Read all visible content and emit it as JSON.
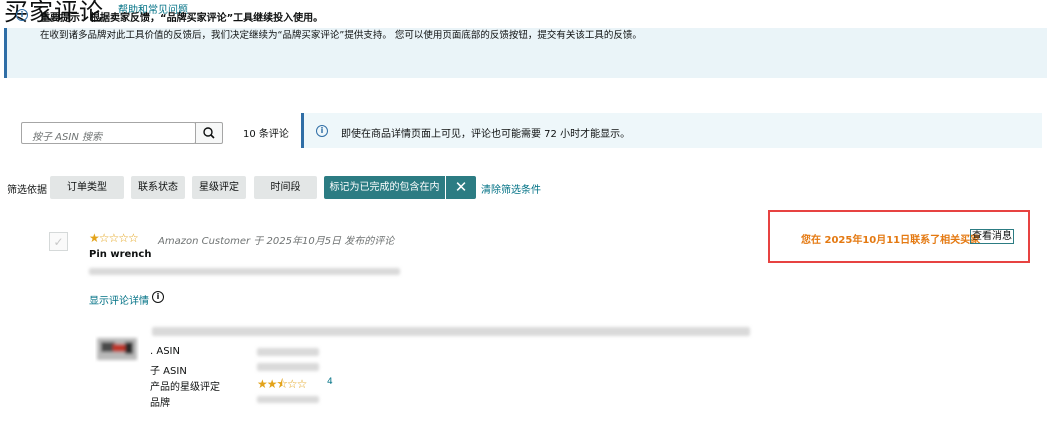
{
  "page": {
    "title": "买家评论",
    "help_link": "帮助和常见问题"
  },
  "alert": {
    "line1": "重要提示：根据卖家反馈，“品牌买家评论”工具继续投入使用。",
    "line2": "在收到诸多品牌对此工具价值的反馈后，我们决定继续为“品牌买家评论”提供支持。 您可以使用页面底部的反馈按钮，提交有关该工具的反馈。"
  },
  "search": {
    "placeholder": "按子 ASIN 搜索",
    "review_count": "10 条评论"
  },
  "info": {
    "text": "即使在商品详情页面上可见，评论也可能需要 72 小时才能显示。"
  },
  "filters": {
    "label": "筛选依据",
    "buttons": [
      "订单类型",
      "联系状态",
      "星级评定",
      "时间段"
    ],
    "active": "标记为已完成的包含在内",
    "close": "✕",
    "clear": "清除筛选条件"
  },
  "review": {
    "stars": "★☆☆☆☆",
    "meta": "Amazon Customer 于 2025年10月5日 发布的评论",
    "title": "Pin wrench",
    "details_link": "显示评论详情",
    "contact_text": "您在 2025年10月11日联系了相关买家",
    "view_message": "查看消息",
    "product": {
      "asin_label": ". ASIN",
      "child_asin_label": "子 ASIN",
      "rating_label": "产品的星级评定",
      "brand_label": "品牌",
      "rating_stars": "★★⯪☆☆",
      "rating_count": "4"
    }
  },
  "colors": {
    "link": "#007185",
    "accent": "#2c7c83",
    "star": "#e3a31a",
    "highlight": "#e74341",
    "contact": "#e47911"
  }
}
